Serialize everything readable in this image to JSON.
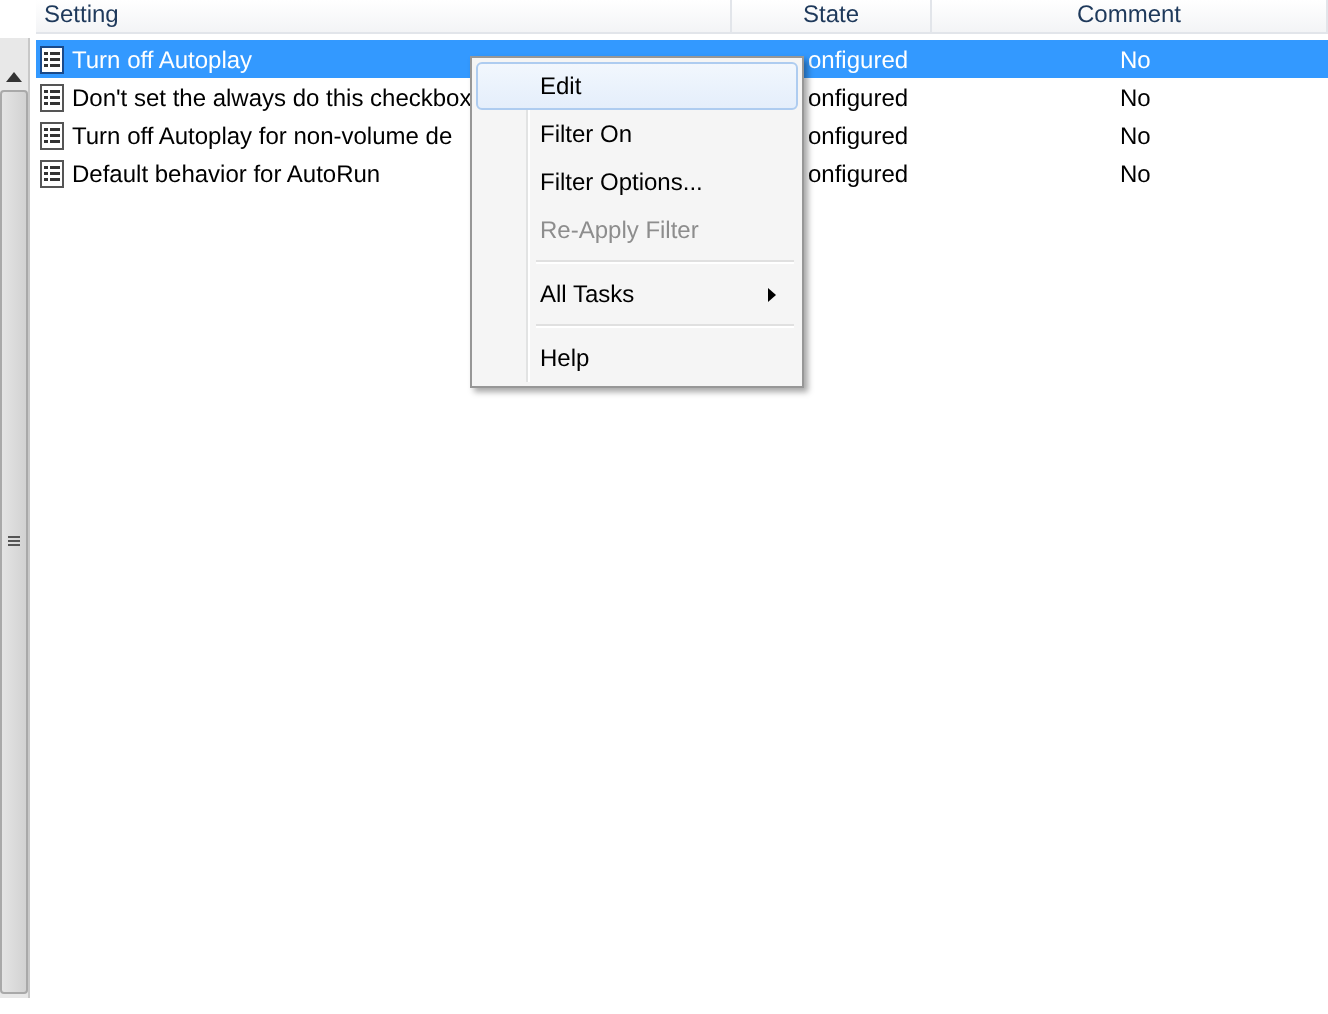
{
  "table": {
    "columns": [
      "Setting",
      "State",
      "Comment"
    ],
    "rows": [
      {
        "setting": "Turn off Autoplay",
        "state": "",
        "comment": "No",
        "selected": true
      },
      {
        "setting": "Don't set the always do this checkbox",
        "state": "onfigured",
        "comment": "No",
        "selected": false
      },
      {
        "setting": "Turn off Autoplay for non-volume de",
        "state": "onfigured",
        "comment": "No",
        "selected": false
      },
      {
        "setting": "Default behavior for AutoRun",
        "state": "onfigured",
        "comment": "No",
        "selected": false
      }
    ]
  },
  "first_row_state": "onfigured",
  "context_menu": {
    "items": [
      {
        "kind": "item",
        "label": "Edit",
        "selected": true,
        "disabled": false,
        "submenu": false
      },
      {
        "kind": "item",
        "label": "Filter On",
        "selected": false,
        "disabled": false,
        "submenu": false
      },
      {
        "kind": "item",
        "label": "Filter Options...",
        "selected": false,
        "disabled": false,
        "submenu": false
      },
      {
        "kind": "item",
        "label": "Re-Apply Filter",
        "selected": false,
        "disabled": true,
        "submenu": false
      },
      {
        "kind": "separator"
      },
      {
        "kind": "item",
        "label": "All Tasks",
        "selected": false,
        "disabled": false,
        "submenu": true
      },
      {
        "kind": "separator"
      },
      {
        "kind": "item",
        "label": "Help",
        "selected": false,
        "disabled": false,
        "submenu": false
      }
    ]
  }
}
